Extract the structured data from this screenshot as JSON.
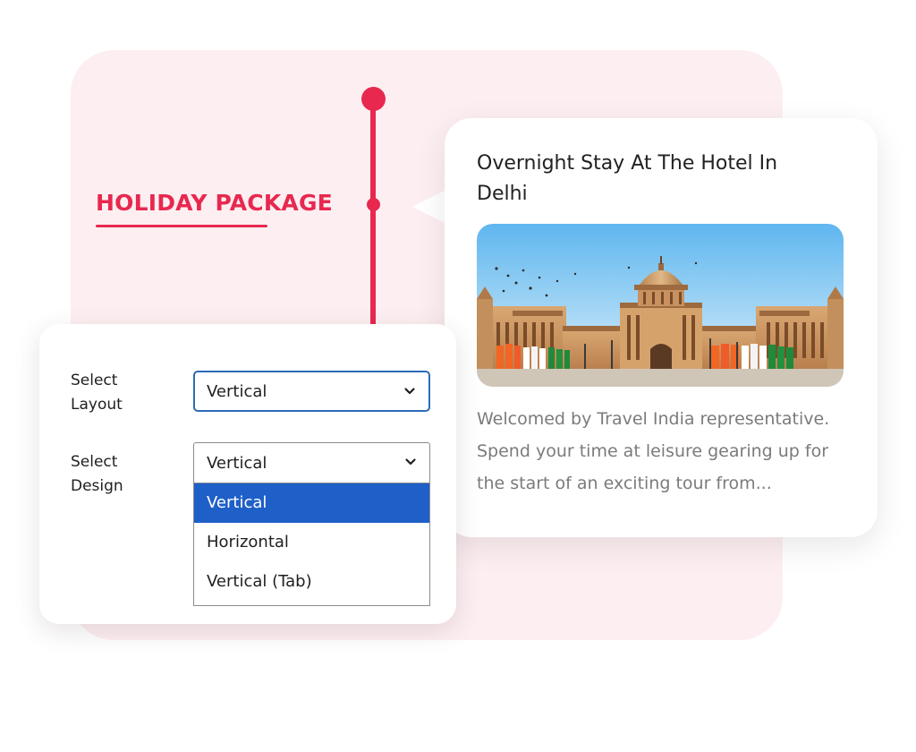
{
  "heading": "HOLIDAY PACKAGE",
  "card": {
    "title": "Overnight Stay At The Hotel In Delhi",
    "description": "Welcomed by Travel India representative. Spend your time at leisure gearing up for the start of an exciting tour from..."
  },
  "settings": {
    "layout_label_line1": "Select",
    "layout_label_line2": "Layout",
    "layout_value": "Vertical",
    "design_label_line1": "Select",
    "design_label_line2": "Design",
    "design_value": "Vertical",
    "design_options": [
      {
        "label": "Vertical",
        "selected": true
      },
      {
        "label": "Horizontal",
        "selected": false
      },
      {
        "label": "Vertical (Tab)",
        "selected": false
      }
    ]
  },
  "icons": {
    "dropdown": "chevron-down-icon"
  },
  "colors": {
    "accent": "#e8284f",
    "panel_background": "#fdeff1",
    "select_focus_border": "#2d6ab8",
    "option_highlight": "#1f5fc8",
    "title_text": "#222222",
    "description_text": "#7b7b7b"
  }
}
